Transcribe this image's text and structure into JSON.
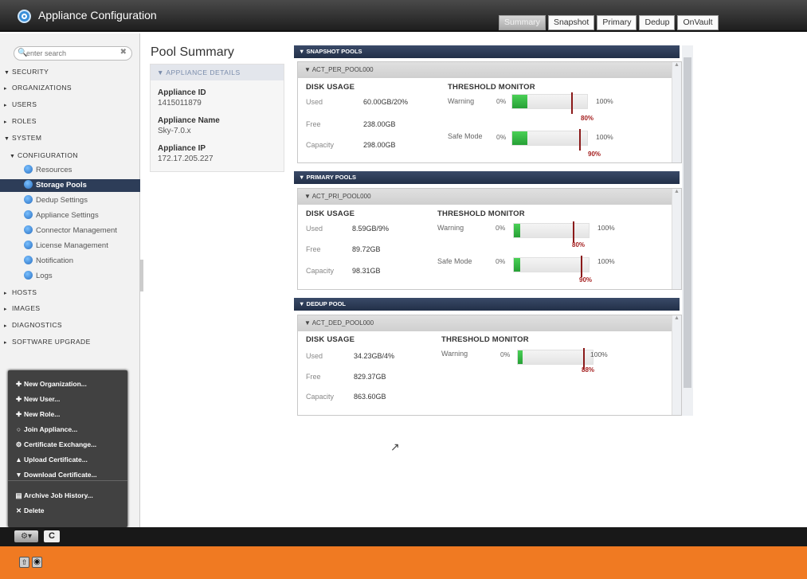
{
  "app": {
    "title": "Appliance Configuration"
  },
  "tabs": [
    "Summary",
    "Snapshot",
    "Primary",
    "Dedup",
    "OnVault"
  ],
  "search": {
    "placeholder": "enter search"
  },
  "nav": {
    "security": "SECURITY",
    "organizations": "ORGANIZATIONS",
    "users": "USERS",
    "roles": "ROLES",
    "system": "SYSTEM",
    "configuration": "CONFIGURATION",
    "items": [
      "Resources",
      "Storage Pools",
      "Dedup Settings",
      "Appliance Settings",
      "Connector Management",
      "License Management",
      "Notification",
      "Logs"
    ],
    "hosts": "HOSTS",
    "images": "IMAGES",
    "diagnostics": "DIAGNOSTICS",
    "software_upgrade": "SOFTWARE UPGRADE"
  },
  "actions": [
    "New Organization...",
    "New User...",
    "New Role...",
    "Join Appliance...",
    "Certificate Exchange...",
    "Upload Certificate...",
    "Download Certificate...",
    "Archive Job History...",
    "Delete"
  ],
  "main": {
    "title": "Pool Summary",
    "details": {
      "header": "APPLIANCE DETAILS",
      "id_label": "Appliance ID",
      "id_value": "1415011879",
      "name_label": "Appliance Name",
      "name_value": "Sky-7.0.x",
      "ip_label": "Appliance IP",
      "ip_value": "172.17.205.227"
    }
  },
  "labels": {
    "disk_usage": "DISK USAGE",
    "threshold": "THRESHOLD MONITOR",
    "used": "Used",
    "free": "Free",
    "capacity": "Capacity",
    "warning": "Warning",
    "safe_mode": "Safe Mode",
    "pct_zero": "0%",
    "pct_full": "100%"
  },
  "sections": {
    "snapshot": {
      "header": "SNAPSHOT POOLS",
      "pool": "ACT_PER_POOL000",
      "used": "60.00GB/20%",
      "free": "238.00GB",
      "capacity": "298.00GB",
      "warning_marker": "80%",
      "safe_marker": "90%",
      "fill_fraction": 0.2,
      "warning_threshold": 0.8,
      "safe_threshold": 0.9
    },
    "primary": {
      "header": "PRIMARY POOLS",
      "pool": "ACT_PRI_POOL000",
      "used": "8.59GB/9%",
      "free": "89.72GB",
      "capacity": "98.31GB",
      "warning_marker": "80%",
      "safe_marker": "90%",
      "fill_fraction": 0.09,
      "warning_threshold": 0.8,
      "safe_threshold": 0.9
    },
    "dedup": {
      "header": "DEDUP POOL",
      "pool": "ACT_DED_POOL000",
      "used": "34.23GB/4%",
      "free": "829.37GB",
      "capacity": "863.60GB",
      "warning_marker": "88%",
      "fill_fraction": 0.04,
      "warning_threshold": 0.88
    }
  },
  "colors": {
    "accent": "#2d3d58",
    "bar_fill": "#3cc04a",
    "threshold": "#8b1a1a",
    "bottom": "#f07a22"
  }
}
